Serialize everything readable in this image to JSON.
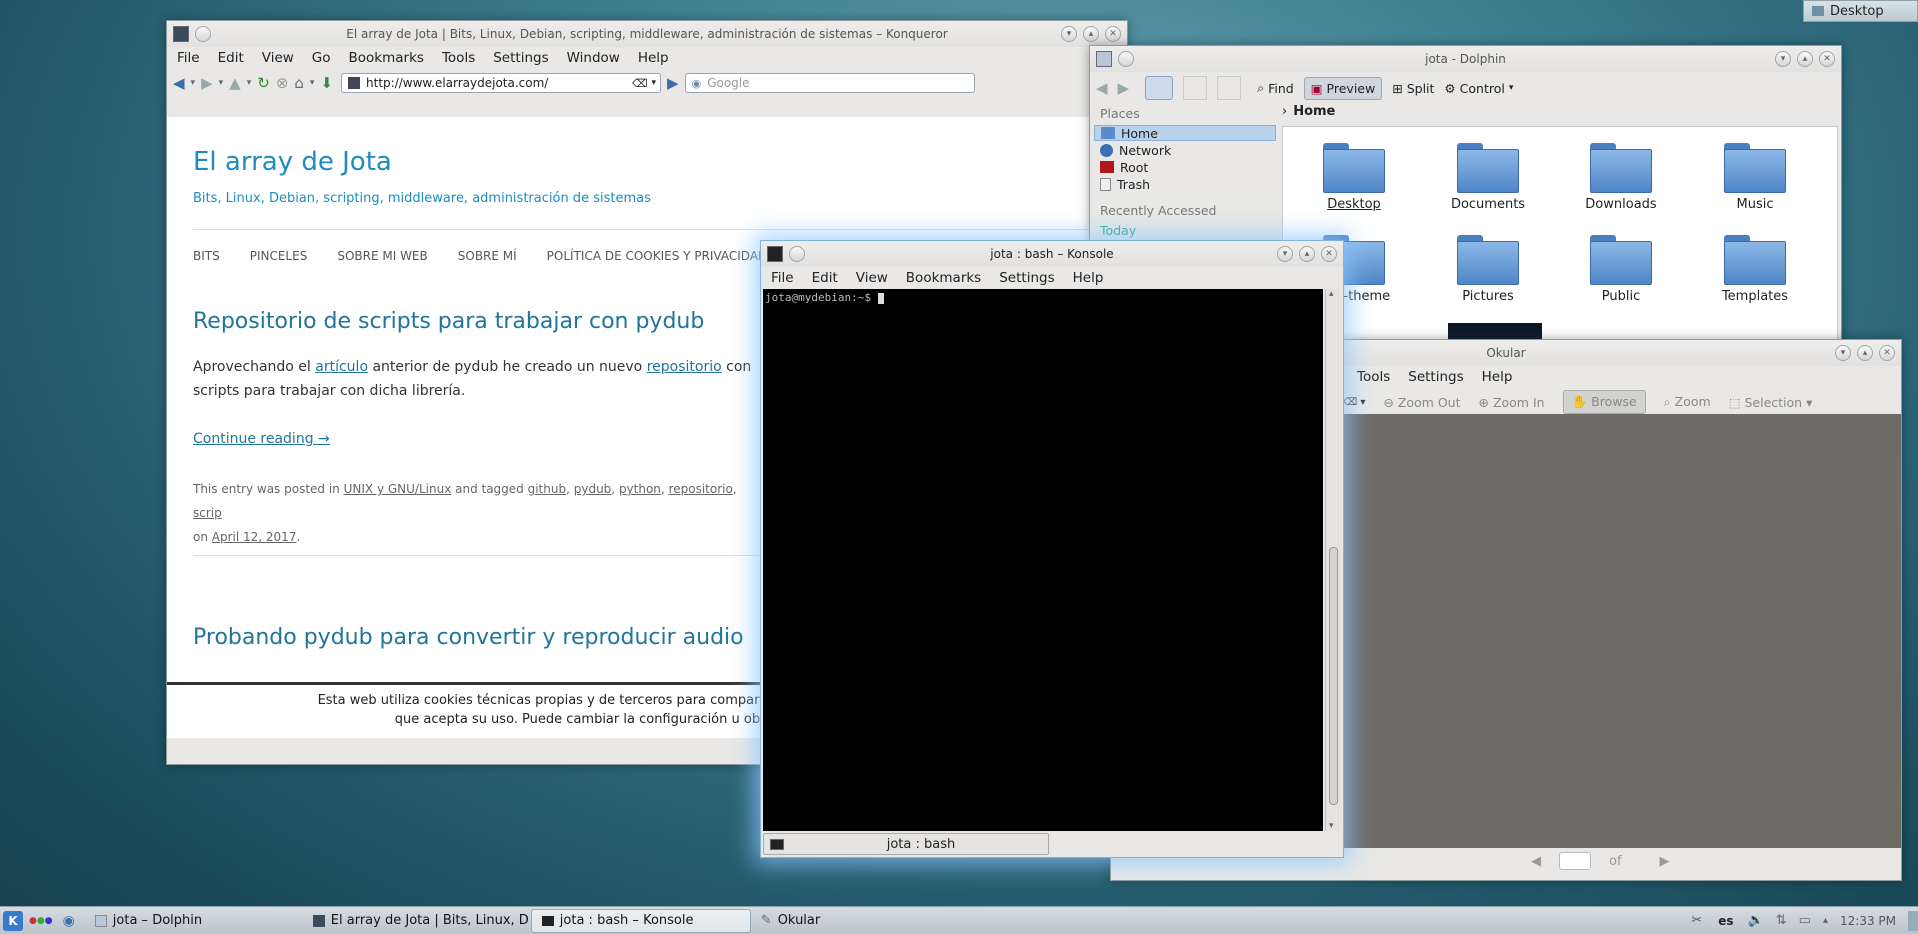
{
  "desktop_button": "Desktop",
  "konqueror": {
    "title": "El array de Jota | Bits, Linux, Debian, scripting, middleware, administración de sistemas – Konqueror",
    "menu": [
      "File",
      "Edit",
      "View",
      "Go",
      "Bookmarks",
      "Tools",
      "Settings",
      "Window",
      "Help"
    ],
    "url": "http://www.elarraydejota.com/",
    "search_placeholder": "Google",
    "site_title": "El array de Jota",
    "site_tagline": "Bits, Linux, Debian, scripting, middleware, administración de sistemas",
    "nav": [
      "BITS",
      "PINCELES",
      "SOBRE MI WEB",
      "SOBRE MÍ",
      "POLÍTICA DE COOKIES Y PRIVACIDAD"
    ],
    "post1_title": "Repositorio de scripts para trabajar con pydub",
    "post1_p_a": "Aprovechando el ",
    "post1_link1": "artículo",
    "post1_p_b": " anterior de pydub he creado un nuevo ",
    "post1_link2": "repositorio",
    "post1_p_c": " con",
    "post1_p_d": "scripts para trabajar con dicha librería.",
    "continue": "Continue reading →",
    "meta_a": "This entry was posted in ",
    "meta_cat": "UNIX y GNU/Linux",
    "meta_b": " and tagged ",
    "tags": [
      "github",
      "pydub",
      "python",
      "repositorio",
      "scrip"
    ],
    "meta_on": "on ",
    "meta_date": "April 12, 2017",
    "meta_end": ".",
    "post2_title": "Probando pydub para convertir y reproducir audio",
    "cookie_line1": "Esta web utiliza cookies técnicas propias y de terceros para compartir en redes sociales y mostrar co",
    "cookie_line2": "que acepta su uso. Puede cambiar la configuración u obtener más informació"
  },
  "dolphin": {
    "title": "jota - Dolphin",
    "tools": {
      "find": "Find",
      "preview": "Preview",
      "split": "Split",
      "control": "Control"
    },
    "places_header": "Places",
    "places": [
      "Home",
      "Network",
      "Root",
      "Trash"
    ],
    "recent_header": "Recently Accessed",
    "recent_partial": "Today",
    "breadcrumb": "Home",
    "folders": [
      "Desktop",
      "Documents",
      "Downloads",
      "Music",
      "-gtk-theme",
      "Pictures",
      "Public",
      "Templates"
    ]
  },
  "konsole": {
    "title": "jota : bash – Konsole",
    "menu": [
      "File",
      "Edit",
      "View",
      "Bookmarks",
      "Settings",
      "Help"
    ],
    "prompt": "jota@mydebian:~$ ",
    "tab": "jota : bash"
  },
  "okular": {
    "title": "Okular",
    "menu": [
      "Tools",
      "Settings",
      "Help"
    ],
    "tools": {
      "zoom_out": "Zoom Out",
      "zoom_in": "Zoom In",
      "browse": "Browse",
      "zoom": "Zoom",
      "selection": "Selection"
    },
    "page_of": "of"
  },
  "taskbar": {
    "tasks": [
      "jota – Dolphin",
      "El array de Jota | Bits, Linux, D",
      "jota : bash – Konsole",
      "Okular"
    ],
    "lang": "es",
    "clock": "12:33 PM"
  }
}
